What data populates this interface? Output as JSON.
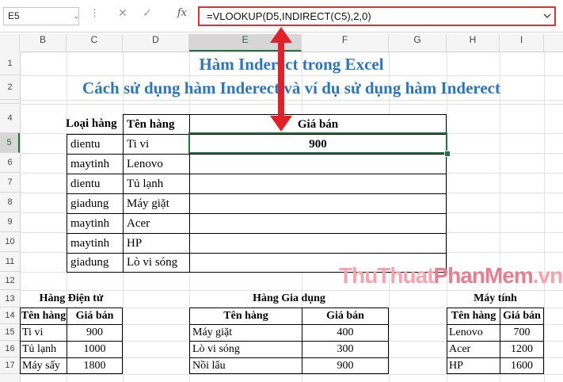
{
  "formula_bar": {
    "cell_ref": "E5",
    "dropdown_glyph": "⌄",
    "dots": "⋮",
    "cancel": "✕",
    "enter": "✓",
    "fx": "fx",
    "formula": "=VLOOKUP(D5,INDIRECT(C5),2,0)"
  },
  "columns": [
    "B",
    "C",
    "D",
    "E",
    "F",
    "G",
    "H",
    "I"
  ],
  "selected_column": "E",
  "rows": [
    "1",
    "2",
    "4",
    "5",
    "6",
    "7",
    "8",
    "9",
    "10",
    "11",
    "12",
    "13",
    "14",
    "15",
    "16",
    "17"
  ],
  "selected_row": "5",
  "titles": {
    "line1": "Hàm Inderect trong Excel",
    "line2": "Cách sử dụng hàm Inderect và ví dụ sử dụng hàm Inderect"
  },
  "main_table": {
    "headers": {
      "loai_hang": "Loại hàng",
      "ten_hang": "Tên hàng",
      "gia_ban": "Giá bán"
    },
    "rows": [
      {
        "loai": "dientu",
        "ten": "Ti vi",
        "gia": "900"
      },
      {
        "loai": "maytinh",
        "ten": "Lenovo",
        "gia": ""
      },
      {
        "loai": "dientu",
        "ten": "Tủ lạnh",
        "gia": ""
      },
      {
        "loai": "giadung",
        "ten": "Máy giặt",
        "gia": ""
      },
      {
        "loai": "maytinh",
        "ten": "Acer",
        "gia": ""
      },
      {
        "loai": "maytinh",
        "ten": "HP",
        "gia": ""
      },
      {
        "loai": "giadung",
        "ten": "Lò vi sóng",
        "gia": ""
      }
    ]
  },
  "dientu_table": {
    "title": "Hàng Điện tử",
    "headers": [
      "Tên hàng",
      "Giá bán"
    ],
    "rows": [
      [
        "Ti vi",
        "900"
      ],
      [
        "Tủ lạnh",
        "1000"
      ],
      [
        "Máy sấy",
        "1800"
      ]
    ]
  },
  "giadung_table": {
    "title": "Hàng  Gia dụng",
    "headers": [
      "Tên hàng",
      "Giá bán"
    ],
    "rows": [
      [
        "Máy giặt",
        "400"
      ],
      [
        "Lò vi sóng",
        "300"
      ],
      [
        "Nồi lẩu",
        "900"
      ]
    ]
  },
  "maytinh_table": {
    "title": "Máy tính",
    "headers": [
      "Tên hàng",
      "Giá bán"
    ],
    "rows": [
      [
        "Lenovo",
        "700"
      ],
      [
        "Acer",
        "1200"
      ],
      [
        "HP",
        "1600"
      ]
    ]
  },
  "watermark": {
    "part1": "ThuThuat",
    "part2": "PhanMem",
    "part3": ".vn"
  },
  "colors": {
    "title_blue": "#2e75b6",
    "excel_green": "#217346",
    "annotation_red": "#e0202a"
  }
}
